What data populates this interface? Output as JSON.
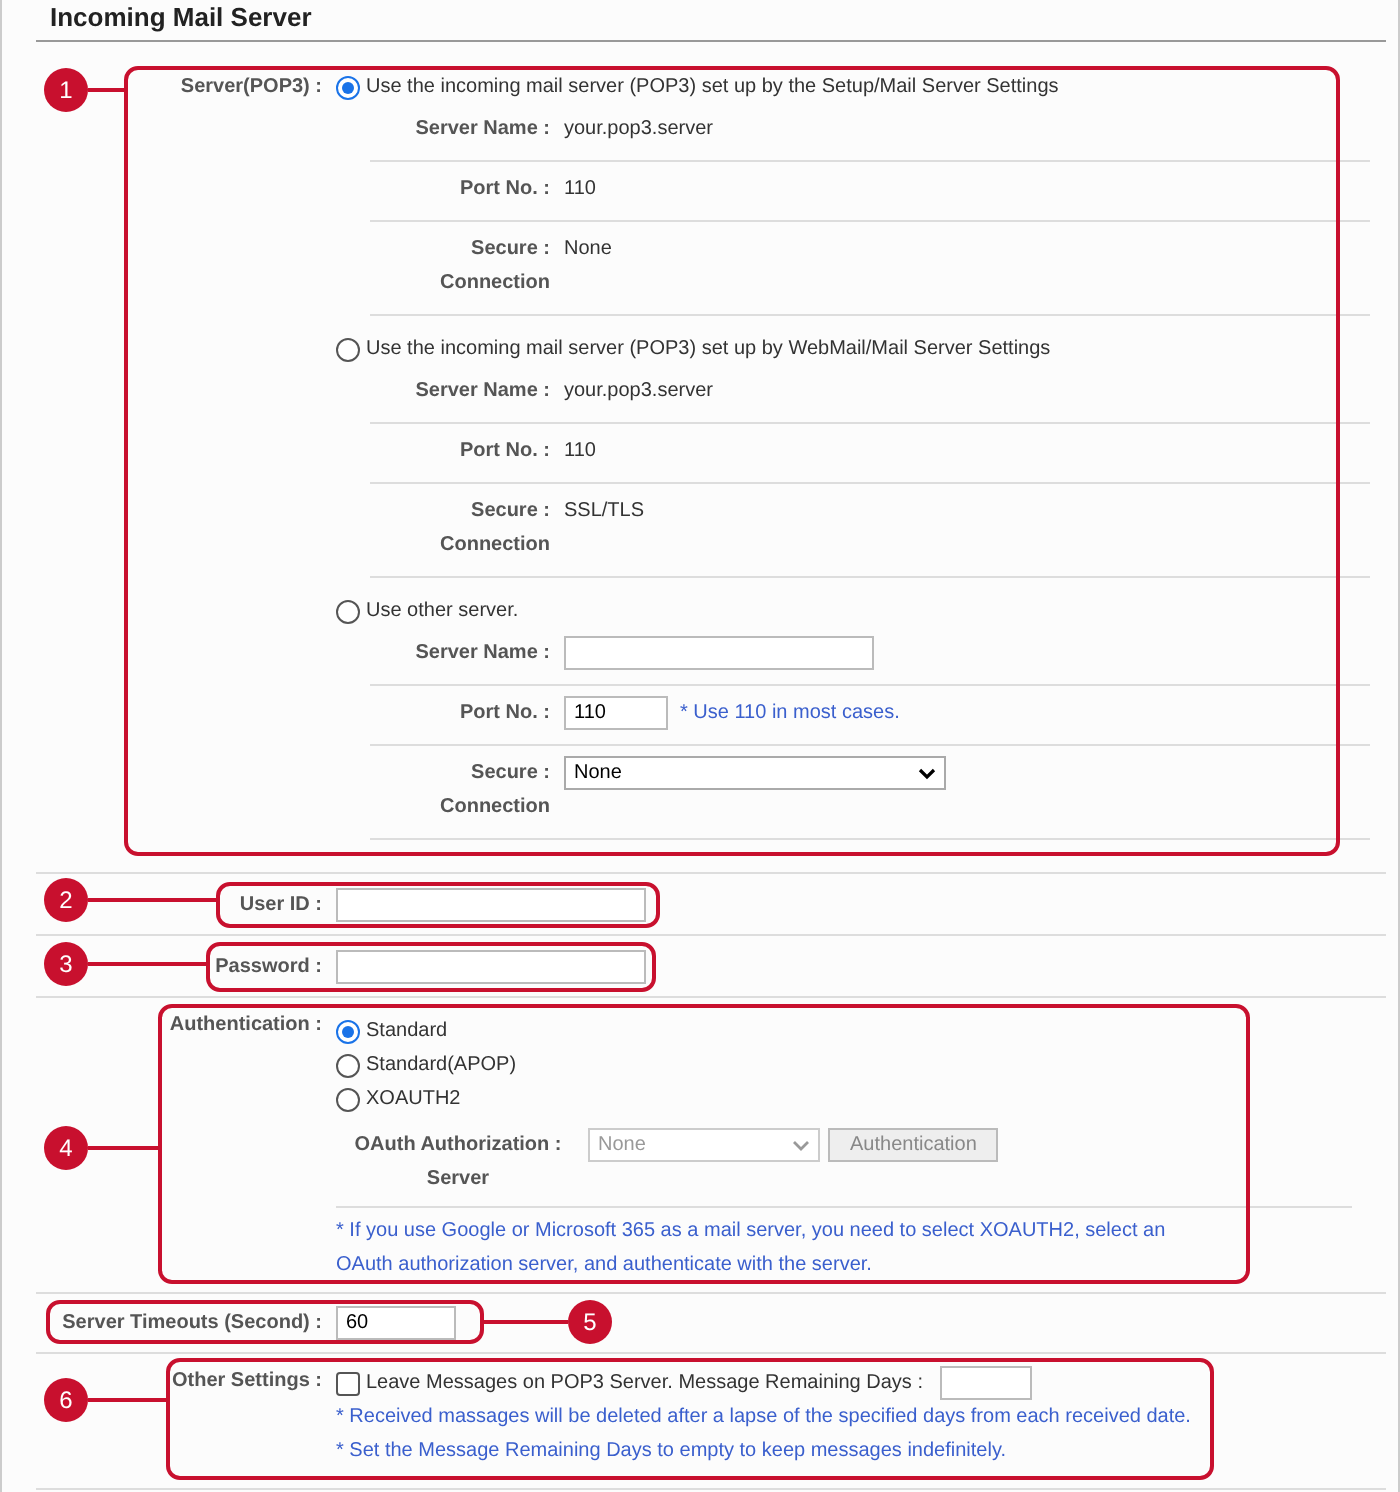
{
  "title": "Incoming Mail Server",
  "server": {
    "callout": "1",
    "label": "Server(POP3) :",
    "options": [
      {
        "label": "Use the incoming mail server (POP3) set up by the Setup/Mail Server Settings",
        "selected": true,
        "fields": [
          {
            "kind": "text",
            "label": "Server Name :",
            "value": "your.pop3.server"
          },
          {
            "kind": "text",
            "label": "Port No. :",
            "value": "110"
          },
          {
            "kind": "text",
            "label": "Secure :",
            "label_2": "Connection",
            "value": "None"
          }
        ]
      },
      {
        "label": "Use the incoming mail server (POP3) set up by WebMail/Mail Server Settings",
        "selected": false,
        "fields": [
          {
            "kind": "text",
            "label": "Server Name :",
            "value": "your.pop3.server"
          },
          {
            "kind": "text",
            "label": "Port No. :",
            "value": "110"
          },
          {
            "kind": "text",
            "label": "Secure :",
            "label_2": "Connection",
            "value": "SSL/TLS"
          }
        ]
      },
      {
        "label": "Use other server.",
        "selected": false,
        "fields": [
          {
            "kind": "input",
            "label": "Server Name :"
          },
          {
            "kind": "port",
            "label": "Port No. :",
            "value": "110",
            "note": "* Use 110 in most cases."
          },
          {
            "kind": "select",
            "label": "Secure :",
            "label_2": "Connection",
            "value": "None"
          }
        ]
      }
    ]
  },
  "user_id": {
    "callout": "2",
    "label": "User ID :"
  },
  "password": {
    "callout": "3",
    "label": "Password :"
  },
  "authentication": {
    "callout": "4",
    "label": "Authentication :",
    "options": [
      {
        "label": "Standard",
        "selected": true
      },
      {
        "label": "Standard(APOP)",
        "selected": false
      },
      {
        "label": "XOAUTH2",
        "selected": false
      }
    ],
    "oauth": {
      "label": "OAuth Authorization :",
      "label_2": "Server",
      "value": "None",
      "disabled": true,
      "button": "Authentication"
    },
    "note": "* If you use Google or Microsoft 365 as a mail server, you need to select XOAUTH2, select an OAuth authorization server, and authenticate with the server."
  },
  "timeout": {
    "callout": "5",
    "label": "Server Timeouts (Second) :",
    "value": "60"
  },
  "other": {
    "callout": "6",
    "label": "Other Settings :",
    "option": {
      "label": "Leave Messages on POP3 Server. Message Remaining Days :",
      "checked": false
    },
    "notes": [
      "* Received massages will be deleted after a lapse of the specified days from each received date.",
      "* Set the Message Remaining Days to empty to keep messages indefinitely."
    ]
  }
}
